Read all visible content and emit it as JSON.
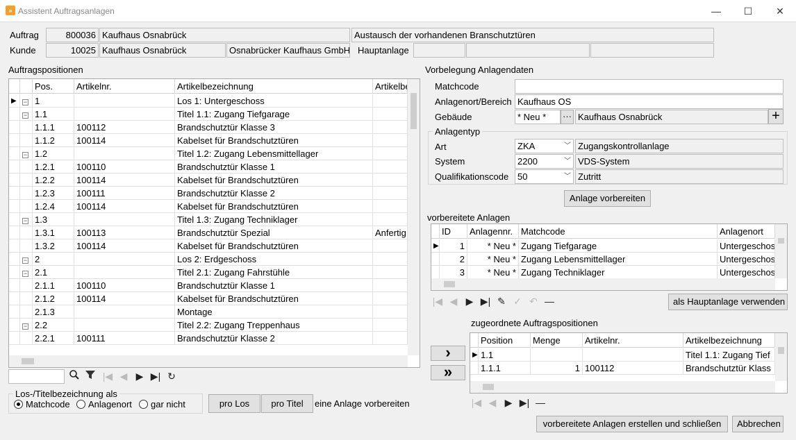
{
  "window": {
    "title": "Assistent Auftragsanlagen",
    "minimize": "—",
    "maximize": "☐",
    "close": "✕"
  },
  "header": {
    "auftrag_label": "Auftrag",
    "auftrag_nr": "800036",
    "auftrag_name": "Kaufhaus Osnabrück",
    "auftrag_desc": "Austausch der vorhandenen Branschutztüren",
    "kunde_label": "Kunde",
    "kunde_nr": "10025",
    "kunde_name": "Kaufhaus Osnabrück",
    "kunde_name2": "Osnabrücker Kaufhaus GmbH",
    "hauptanlage_label": "Hauptanlage"
  },
  "positions": {
    "title": "Auftragspositionen",
    "columns": [
      "Pos.",
      "Artikelnr.",
      "Artikelbezeichnung",
      "Artikelbe"
    ],
    "rows": [
      {
        "pos": "1",
        "art": "",
        "bez": "Los 1: Untergeschoss",
        "extra": "",
        "group": true,
        "cur": true
      },
      {
        "pos": "1.1",
        "art": "",
        "bez": "Titel 1.1: Zugang Tiefgarage",
        "extra": "",
        "group": true
      },
      {
        "pos": "1.1.1",
        "art": "100112",
        "bez": "Brandschutztür Klasse 3",
        "extra": ""
      },
      {
        "pos": "1.1.2",
        "art": "100114",
        "bez": "Kabelset für Brandschutztüren",
        "extra": ""
      },
      {
        "pos": "1.2",
        "art": "",
        "bez": "Titel 1.2: Zugang Lebensmittellager",
        "extra": "",
        "group": true
      },
      {
        "pos": "1.2.1",
        "art": "100110",
        "bez": "Brandschutztür Klasse 1",
        "extra": ""
      },
      {
        "pos": "1.2.2",
        "art": "100114",
        "bez": "Kabelset für Brandschutztüren",
        "extra": ""
      },
      {
        "pos": "1.2.3",
        "art": "100111",
        "bez": "Brandschutztür Klasse 2",
        "extra": ""
      },
      {
        "pos": "1.2.4",
        "art": "100114",
        "bez": "Kabelset für Brandschutztüren",
        "extra": ""
      },
      {
        "pos": "1.3",
        "art": "",
        "bez": "Titel 1.3: Zugang Techniklager",
        "extra": "",
        "group": true
      },
      {
        "pos": "1.3.1",
        "art": "100113",
        "bez": "Brandschutztür Spezial",
        "extra": "Anfertig"
      },
      {
        "pos": "1.3.2",
        "art": "100114",
        "bez": "Kabelset für Brandschutztüren",
        "extra": ""
      },
      {
        "pos": "2",
        "art": "",
        "bez": "Los 2: Erdgeschoss",
        "extra": "",
        "group": true
      },
      {
        "pos": "2.1",
        "art": "",
        "bez": "Titel 2.1: Zugang Fahrstühle",
        "extra": "",
        "group": true
      },
      {
        "pos": "2.1.1",
        "art": "100110",
        "bez": "Brandschutztür Klasse 1",
        "extra": ""
      },
      {
        "pos": "2.1.2",
        "art": "100114",
        "bez": "Kabelset für Brandschutztüren",
        "extra": ""
      },
      {
        "pos": "2.1.3",
        "art": "",
        "bez": "Montage",
        "extra": ""
      },
      {
        "pos": "2.2",
        "art": "",
        "bez": "Titel 2.2: Zugang Treppenhaus",
        "extra": "",
        "group": true
      },
      {
        "pos": "2.2.1",
        "art": "100111",
        "bez": "Brandschutztür Klasse 2",
        "extra": ""
      }
    ]
  },
  "los_group": {
    "legend": "Los-/Titelbezeichnung als",
    "opt1": "Matchcode",
    "opt2": "Anlagenort",
    "opt3": "gar nicht"
  },
  "buttons": {
    "pro_los": "pro Los",
    "pro_titel": "pro Titel",
    "eine_anlage": "eine Anlage vorbereiten",
    "anlage_vorbereiten": "Anlage vorbereiten",
    "als_hauptanlage": "als Hauptanlage verwenden",
    "erstellen": "vorbereitete Anlagen erstellen und schließen",
    "abbrechen": "Abbrechen"
  },
  "vorbelegung": {
    "title": "Vorbelegung Anlagendaten",
    "matchcode_label": "Matchcode",
    "matchcode": "",
    "ort_label": "Anlagenort/Bereich",
    "ort": "Kaufhaus OS",
    "gebaeude_label": "Gebäude",
    "gebaeude": "* Neu *",
    "gebaeude_name": "Kaufhaus Osnabrück",
    "typ_legend": "Anlagentyp",
    "art_label": "Art",
    "art": "ZKA",
    "art_desc": "Zugangskontrollanlage",
    "system_label": "System",
    "system": "2200",
    "system_desc": "VDS-System",
    "quali_label": "Qualifikationscode",
    "quali": "50",
    "quali_desc": "Zutritt"
  },
  "prepared": {
    "title": "vorbereitete Anlagen",
    "columns": [
      "ID",
      "Anlagennr.",
      "Matchcode",
      "Anlagenort"
    ],
    "rows": [
      {
        "id": "1",
        "nr": "* Neu *",
        "mc": "Zugang Tiefgarage",
        "ort": "Untergeschos"
      },
      {
        "id": "2",
        "nr": "* Neu *",
        "mc": "Zugang Lebensmittellager",
        "ort": "Untergeschos"
      },
      {
        "id": "3",
        "nr": "* Neu *",
        "mc": "Zugang Techniklager",
        "ort": "Untergeschos"
      }
    ]
  },
  "assigned": {
    "title": "zugeordnete Auftragspositionen",
    "columns": [
      "Position",
      "Menge",
      "Artikelnr.",
      "Artikelbezeichnung"
    ],
    "rows": [
      {
        "pos": "1.1",
        "menge": "",
        "art": "",
        "bez": "Titel 1.1: Zugang Tief"
      },
      {
        "pos": "1.1.1",
        "menge": "1",
        "art": "100112",
        "bez": "Brandschutztür Klass"
      }
    ]
  },
  "icons": {
    "arrow_right": "›",
    "arrow_right_double": "»"
  }
}
